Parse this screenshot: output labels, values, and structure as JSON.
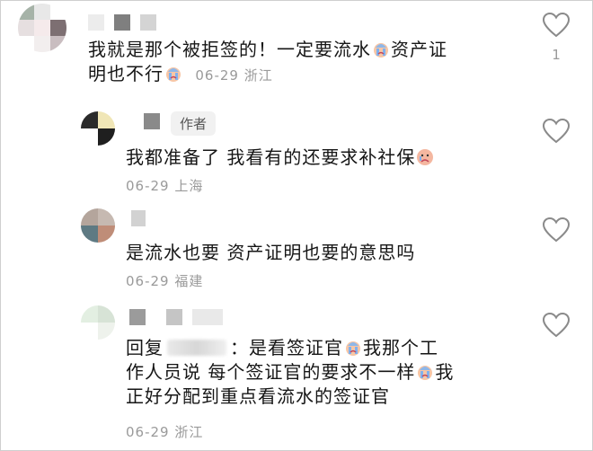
{
  "comments": [
    {
      "text_a": "我就是那个被拒签的！一定要流水",
      "text_b": "资产证",
      "text_c": "明也不行",
      "date": "06-29",
      "location": "浙江",
      "like_count": "1",
      "emoji_icons": [
        "crying-emoji-icon",
        "crying-emoji-icon"
      ]
    },
    {
      "author_tag": "作者",
      "text_a": "我都准备了 我看有的还要求补社保",
      "date": "06-29",
      "location": "上海",
      "emoji_icons": [
        "pouting-emoji-icon"
      ]
    },
    {
      "text_a": "是流水也要 资产证明也要的意思吗",
      "date": "06-29",
      "location": "福建"
    },
    {
      "reply_prefix": "回复",
      "reply_suffix": "：是看签证官",
      "text_b": "我那个工",
      "text_c": "作人员说 每个签证官的要求不一样",
      "text_d": "我",
      "text_e": "正好分配到重点看流水的签证官",
      "date": "06-29",
      "location": "浙江",
      "emoji_icons": [
        "crying-emoji-icon",
        "crying-emoji-icon"
      ]
    }
  ],
  "colors": {
    "text": "#161616",
    "meta": "#9a9a9a",
    "heart_outline": "#8a8a8a"
  }
}
